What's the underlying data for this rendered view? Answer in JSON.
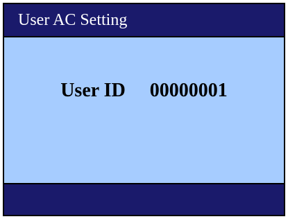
{
  "window": {
    "title": "User AC Setting"
  },
  "user": {
    "id_label": "User ID",
    "id_value": "00000001"
  },
  "colors": {
    "title_bar": "#1a1a6b",
    "content_background": "#a6ccff",
    "border": "#000000",
    "title_text": "#ffffff",
    "body_text": "#000000"
  }
}
